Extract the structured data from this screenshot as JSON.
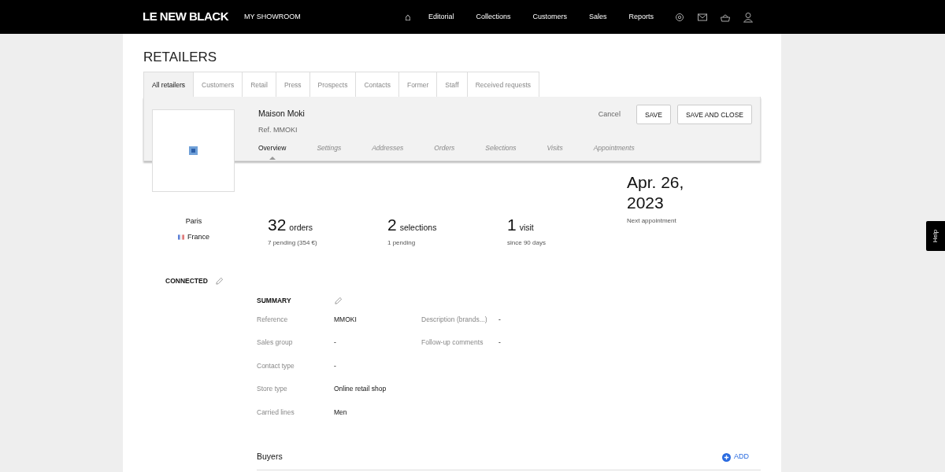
{
  "navbar": {
    "brand": "LE NEW BLACK",
    "section": "MY SHOWROOM",
    "home_icon": "⌂",
    "links": [
      {
        "label": "Editorial"
      },
      {
        "label": "Collections"
      },
      {
        "label": "Customers"
      },
      {
        "label": "Sales"
      },
      {
        "label": "Reports"
      }
    ]
  },
  "page": {
    "title": "RETAILERS"
  },
  "tabs": [
    {
      "label": "All retailers",
      "selected": true
    },
    {
      "label": "Customers",
      "selected": false
    },
    {
      "label": "Retail",
      "selected": false
    },
    {
      "label": "Press",
      "selected": false
    },
    {
      "label": "Prospects",
      "selected": false
    },
    {
      "label": "Contacts",
      "selected": false
    },
    {
      "label": "Former",
      "selected": false
    },
    {
      "label": "Staff",
      "selected": false
    },
    {
      "label": "Received requests",
      "selected": false
    }
  ],
  "retailer": {
    "name": "Maison Moki",
    "reference": "Ref. MMOKI",
    "actions": {
      "cancel": "Cancel",
      "save": "SAVE",
      "save_close": "SAVE AND CLOSE"
    },
    "subtabs": [
      {
        "label": "Overview",
        "selected": true
      },
      {
        "label": "Settings",
        "selected": false
      },
      {
        "label": "Addresses",
        "selected": false
      },
      {
        "label": "Orders",
        "selected": false
      },
      {
        "label": "Selections",
        "selected": false
      },
      {
        "label": "Visits",
        "selected": false
      },
      {
        "label": "Appointments",
        "selected": false
      }
    ]
  },
  "location": {
    "city": "Paris",
    "country": "France"
  },
  "stats": [
    {
      "number": "32",
      "unit": "orders",
      "sub": "7 pending (354 €)"
    },
    {
      "number": "2",
      "unit": "selections",
      "sub": "1 pending"
    },
    {
      "number": "1",
      "unit": "visit",
      "sub": "since 90 days"
    },
    {
      "kind": "date",
      "number": "Apr. 26, 2023",
      "sub": "Next appointment"
    }
  ],
  "status": "CONNECTED",
  "summary": {
    "title": "SUMMARY",
    "rows": [
      [
        {
          "label": "Reference",
          "value": "MMOKI"
        },
        {
          "label": "Description (brands...)",
          "value": "-"
        }
      ],
      [
        {
          "label": "Sales group",
          "value": "-"
        },
        {
          "label": "Follow-up comments",
          "value": "-"
        }
      ],
      [
        {
          "label": "Contact type",
          "value": "-"
        }
      ],
      [
        {
          "label": "Store type",
          "value": "Online retail shop"
        }
      ],
      [
        {
          "label": "Carried lines",
          "value": "Men"
        }
      ]
    ]
  },
  "buyers": {
    "title": "Buyers",
    "add": "ADD"
  },
  "help": "Help"
}
